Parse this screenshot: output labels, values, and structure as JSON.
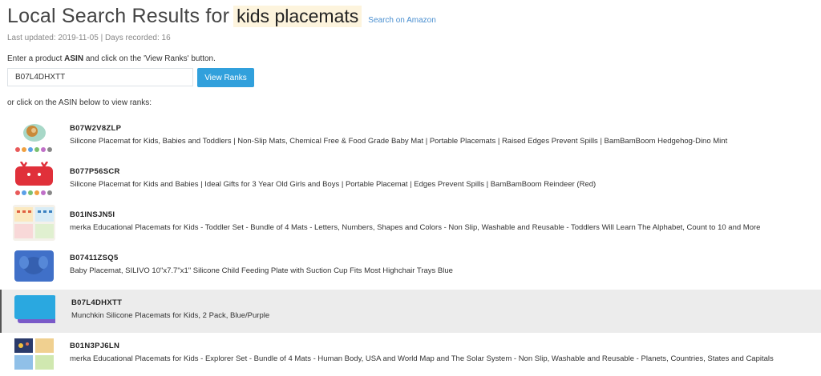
{
  "header": {
    "title": "Local Search Results for",
    "keyword": "kids placemats",
    "amazon_link": "Search on Amazon"
  },
  "meta": "Last updated: 2019-11-05 |  Days recorded: 16",
  "instructions": {
    "prefix": "Enter a product ",
    "bold": "ASIN",
    "suffix": " and click on the 'View Ranks' button."
  },
  "asin_input": {
    "value": "B07L4DHXTT"
  },
  "view_button": "View Ranks",
  "or_text": "or click on the ASIN below to view ranks:",
  "products": [
    {
      "asin": "B07W2V8ZLP",
      "title": "Silicone Placemat for Kids, Babies and Toddlers | Non-Slip Mats, Chemical Free & Food Grade Baby Mat | Portable Placemats | Raised Edges Prevent Spills | BamBamBoom Hedgehog-Dino Mint"
    },
    {
      "asin": "B077P56SCR",
      "title": "Silicone Placemat for Kids and Babies | Ideal Gifts for 3 Year Old Girls and Boys | Portable Placemat | Edges Prevent Spills | BamBamBoom Reindeer (Red)"
    },
    {
      "asin": "B01INSJN5I",
      "title": "merka Educational Placemats for Kids - Toddler Set - Bundle of 4 Mats - Letters, Numbers, Shapes and Colors - Non Slip, Washable and Reusable - Toddlers Will Learn The Alphabet, Count to 10 and More"
    },
    {
      "asin": "B07411ZSQ5",
      "title": "Baby Placemat, SILIVO 10\"x7.7\"x1\" Silicone Child Feeding Plate with Suction Cup Fits Most Highchair Trays Blue"
    },
    {
      "asin": "B07L4DHXTT",
      "title": "Munchkin Silicone Placemats for Kids, 2 Pack, Blue/Purple"
    },
    {
      "asin": "B01N3PJ6LN",
      "title": "merka Educational Placemats for Kids - Explorer Set - Bundle of 4 Mats - Human Body, USA and World Map and The Solar System - Non Slip, Washable and Reusable - Planets, Countries, States and Capitals"
    }
  ],
  "colors": {
    "accent": "#31a0dc",
    "link": "#4a8fd0",
    "highlight": "#fdf4dd",
    "selected_row": "#ececec"
  }
}
